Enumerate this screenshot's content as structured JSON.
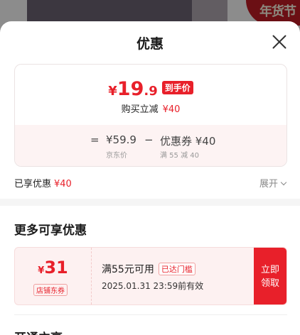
{
  "backdrop": {
    "festival_badge": "年货节"
  },
  "sheet": {
    "title": "优惠"
  },
  "price_card": {
    "currency": "¥",
    "final_price_int": "19",
    "final_price_dec": ".9",
    "final_badge": "到手价",
    "buy_reduce_label": "购买立减",
    "buy_reduce_value": "¥40",
    "calc": {
      "equals": "=",
      "jd_price": "¥59.9",
      "jd_price_label": "京东价",
      "minus": "−",
      "coupon_text": "优惠券 ¥40",
      "coupon_condition": "满 55 减 40"
    }
  },
  "enjoyed": {
    "label": "已享优惠",
    "value": "¥40",
    "expand_label": "展开"
  },
  "more": {
    "title": "更多可享优惠"
  },
  "coupon": {
    "currency": "¥",
    "amount": "31",
    "type_tag": "店铺东券",
    "condition": "满55元可用",
    "reached_tag": "已达门槛",
    "valid_until": "2025.01.31 23:59前有效",
    "claim_line1": "立即",
    "claim_line2": "领取"
  },
  "open_section": {
    "title": "开通立享"
  },
  "colors": {
    "accent_red": "#e8202a",
    "card_pink": "#fdf3f3"
  }
}
